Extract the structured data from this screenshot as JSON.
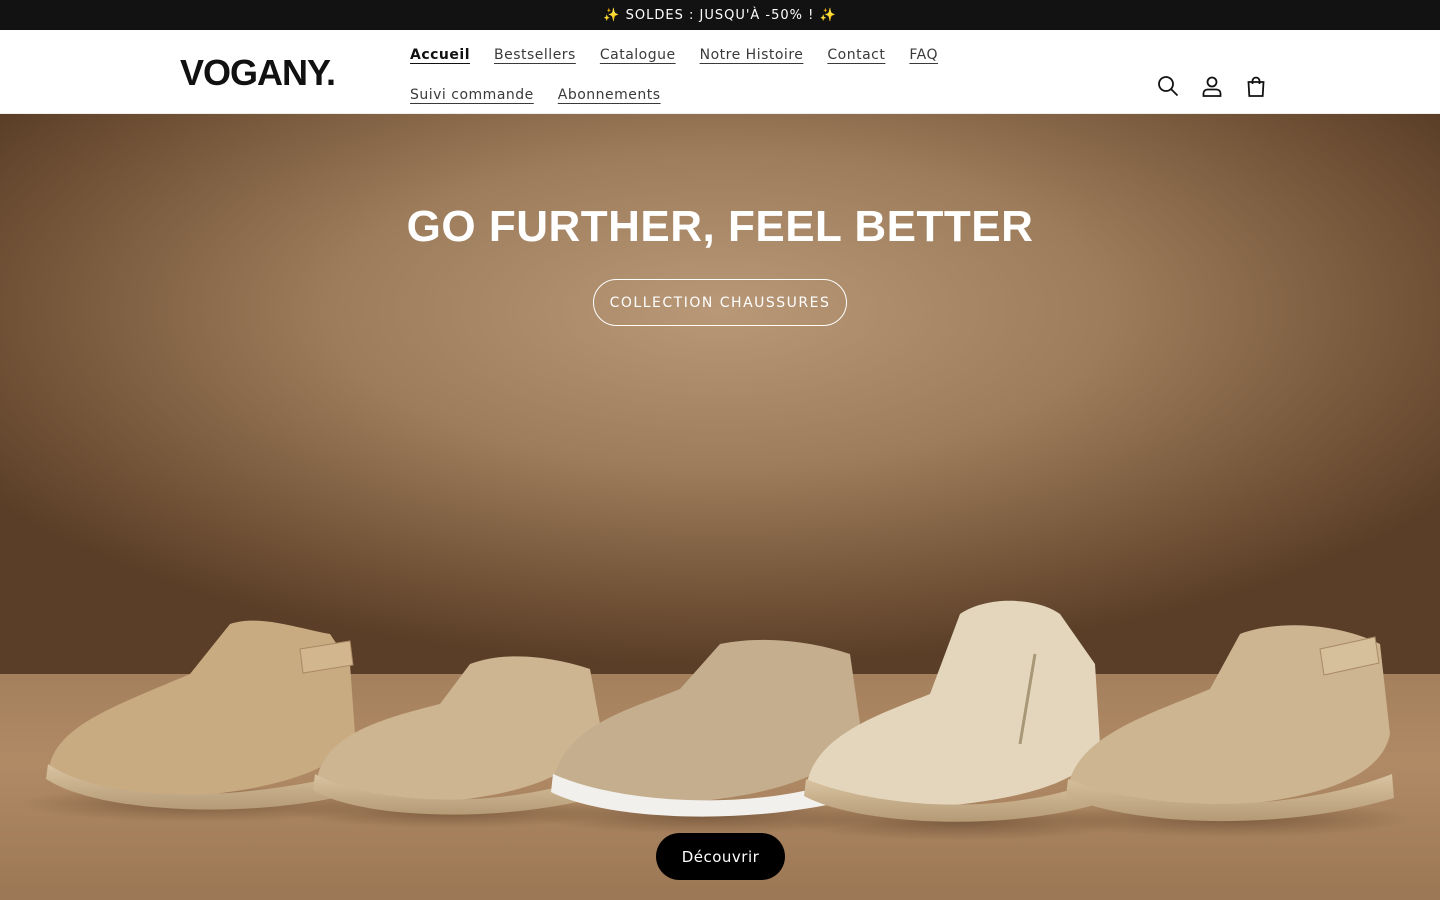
{
  "announcement": "✨ SOLDES : JUSQU'À -50% ! ✨",
  "brand": {
    "logo_text": "VOGANY."
  },
  "nav": {
    "items": [
      {
        "label": "Accueil",
        "active": true
      },
      {
        "label": "Bestsellers"
      },
      {
        "label": "Catalogue"
      },
      {
        "label": "Notre Histoire"
      },
      {
        "label": "Contact"
      },
      {
        "label": "FAQ"
      },
      {
        "label": "Suivi commande"
      },
      {
        "label": "Abonnements"
      }
    ]
  },
  "header_icons": [
    "search-icon",
    "account-icon",
    "cart-icon"
  ],
  "hero": {
    "title": "GO FURTHER, FEEL BETTER",
    "cta_label": "COLLECTION CHAUSSURES",
    "discover_label": "Découvrir"
  },
  "colors": {
    "announcement_bg": "#121212",
    "hero_bg": "#9d7c5b",
    "discover_bg": "#000000"
  }
}
